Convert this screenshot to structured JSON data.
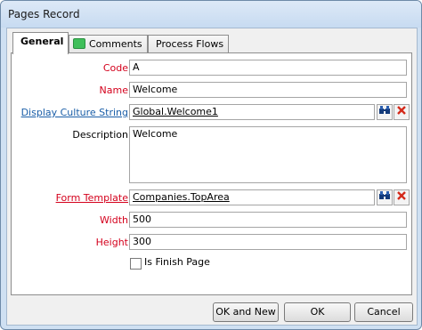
{
  "window": {
    "title": "Pages Record"
  },
  "tabs": [
    {
      "label": "General",
      "active": true
    },
    {
      "label": "Comments",
      "active": false
    },
    {
      "label": "Process Flows",
      "active": false
    }
  ],
  "form": {
    "code": {
      "label": "Code",
      "value": "A"
    },
    "name": {
      "label": "Name",
      "value": "Welcome"
    },
    "display_culture_string": {
      "label": "Display Culture String",
      "value": "Global.Welcome1"
    },
    "description": {
      "label": "Description",
      "value": "Welcome"
    },
    "form_template": {
      "label": "Form Template",
      "value": "Companies.TopArea"
    },
    "width": {
      "label": "Width",
      "value": "500"
    },
    "height": {
      "label": "Height",
      "value": "300"
    },
    "is_finish_page": {
      "label": "Is Finish Page",
      "checked": false
    }
  },
  "buttons": {
    "ok_and_new": "OK and New",
    "ok": "OK",
    "cancel": "Cancel"
  },
  "colors": {
    "required": "#d4001c",
    "link": "#1a5ea8"
  },
  "icons": {
    "lookup": "binoculars-icon",
    "clear": "red-x-icon",
    "comments": "speech-bubble-icon"
  }
}
